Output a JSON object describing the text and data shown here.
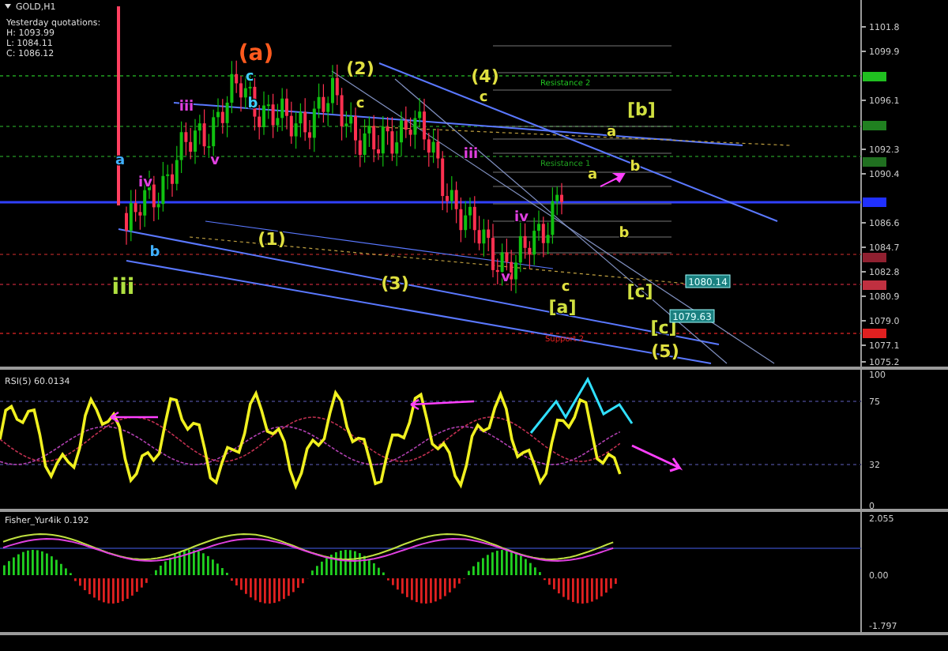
{
  "chart": {
    "symbol": "GOLD,H1",
    "info_lines": [
      "Yesterday quotations:",
      "H: 1093.99",
      "L: 1084.11",
      "C: 1086.12"
    ],
    "price_axis": [
      "1101.8",
      "1099.9",
      "1096.1",
      "1092.3",
      "1090.4",
      "1086.6",
      "1084.7",
      "1082.8",
      "1080.9",
      "1079.0",
      "1077.1",
      "1075.2"
    ],
    "price_tags": [
      {
        "text": "1080.14"
      },
      {
        "text": "1079.63"
      }
    ],
    "level_labels": [
      {
        "text": "Resistance 2",
        "color": "#20c020"
      },
      {
        "text": "Resistance 1",
        "color": "#20a020"
      },
      {
        "text": "Support 2",
        "color": "#e02020"
      }
    ],
    "wave_labels": [
      {
        "text": "(a)",
        "color": "#ff5a1e"
      },
      {
        "text": "c",
        "color": "#40d0ff"
      },
      {
        "text": "(2)",
        "color": "#e0e040"
      },
      {
        "text": "(4)",
        "color": "#e0e040"
      },
      {
        "text": "(1)",
        "color": "#e0e040"
      },
      {
        "text": "(3)",
        "color": "#e0e040"
      },
      {
        "text": "(5)",
        "color": "#e0e040"
      },
      {
        "text": "[b]",
        "color": "#d0e040"
      },
      {
        "text": "[a]",
        "color": "#d0e040"
      },
      {
        "text": "[c]",
        "color": "#d0e040"
      },
      {
        "text": "[c]",
        "color": "#d0e040"
      },
      {
        "text": "iii",
        "color": "#b0e040"
      },
      {
        "text": "a",
        "color": "#40b0ff"
      },
      {
        "text": "b",
        "color": "#40b0ff"
      },
      {
        "text": "b",
        "color": "#40d0ff"
      },
      {
        "text": "c",
        "color": "#e0e040"
      },
      {
        "text": "c",
        "color": "#e0e040"
      },
      {
        "text": "a",
        "color": "#e0e040"
      },
      {
        "text": "b",
        "color": "#e0e040"
      },
      {
        "text": "iii",
        "color": "#e040e0"
      },
      {
        "text": "iv",
        "color": "#e040e0"
      },
      {
        "text": "v",
        "color": "#e040e0"
      },
      {
        "text": "iii",
        "color": "#e040e0"
      },
      {
        "text": "iv",
        "color": "#e040e0"
      },
      {
        "text": "v",
        "color": "#e040e0"
      },
      {
        "text": "c",
        "color": "#e0e040"
      },
      {
        "text": "a",
        "color": "#e0e040"
      },
      {
        "text": "b",
        "color": "#e0e040"
      }
    ]
  },
  "rsi": {
    "title": "RSI(5) 60.0134",
    "axis": [
      "100",
      "75",
      "32",
      "0"
    ]
  },
  "fisher": {
    "title": "Fisher_Yur4ik 0.192",
    "axis": [
      "2.055",
      "0.00",
      "-1.797"
    ]
  }
}
